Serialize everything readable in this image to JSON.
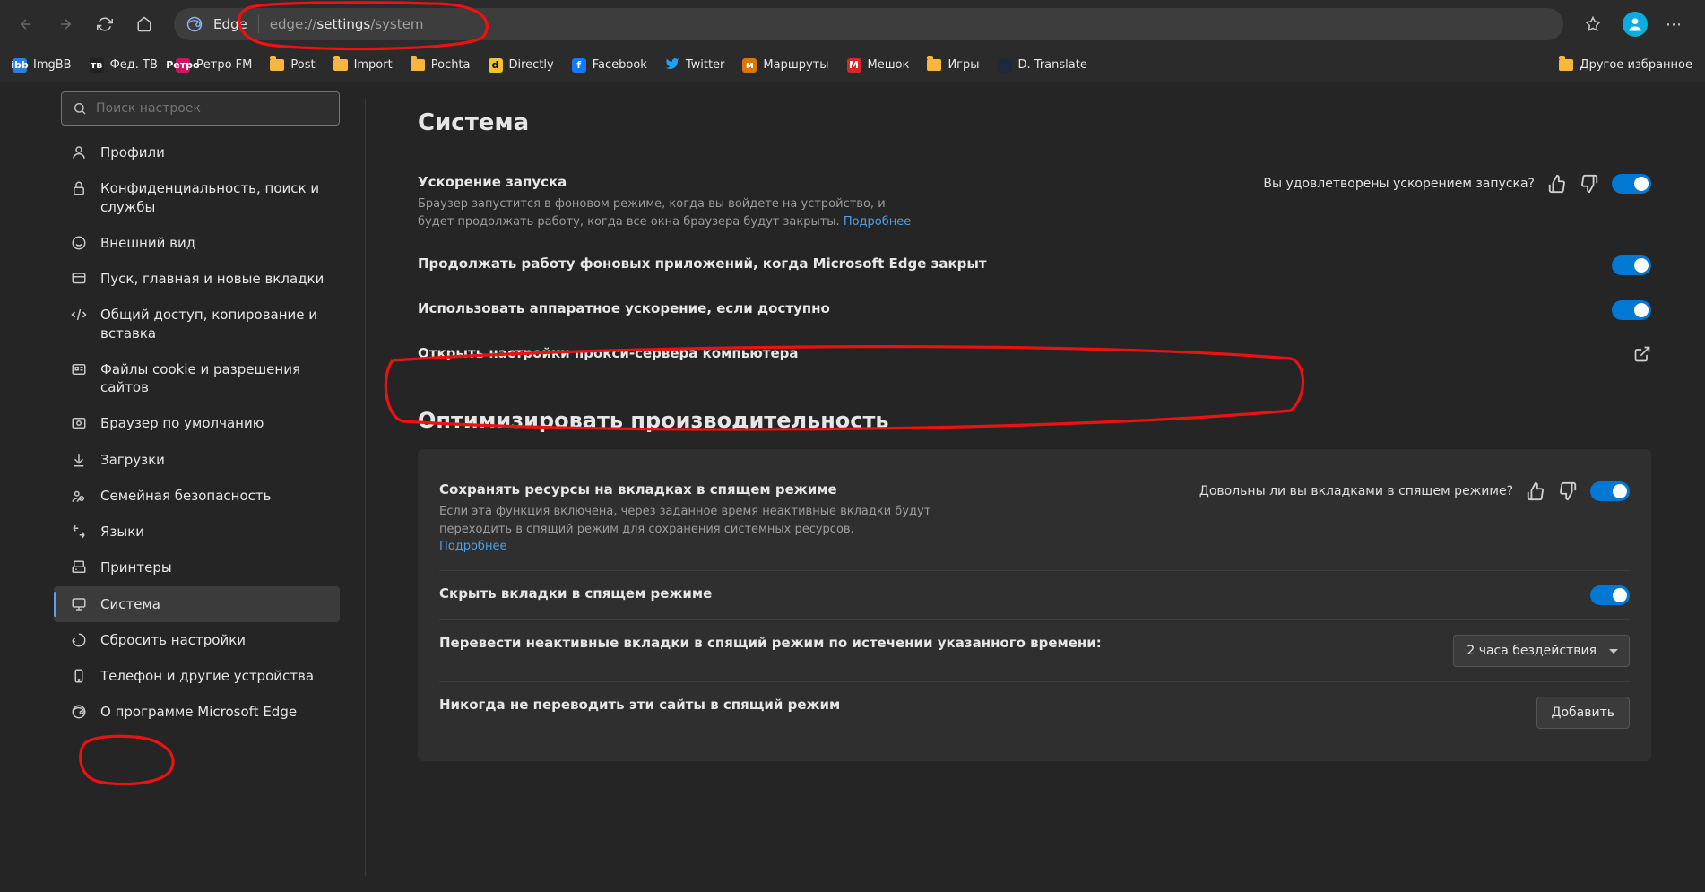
{
  "toolbar": {
    "edge_label": "Edge",
    "url_pre": "edge://",
    "url_mid": "settings",
    "url_post": "/system"
  },
  "bookmarks": {
    "items": [
      {
        "label": "ImgBB",
        "bg": "#2a7fe0",
        "txt": "ibb"
      },
      {
        "label": "Фед. ТВ",
        "bg": "#222",
        "txt": "тв"
      },
      {
        "label": "Ретро FM",
        "bg": "#c91664",
        "txt": "Ретро"
      },
      {
        "label": "Post",
        "folder": true
      },
      {
        "label": "Import",
        "folder": true
      },
      {
        "label": "Pochta",
        "folder": true
      },
      {
        "label": "Directly",
        "bg": "#f4c430",
        "txt": "d",
        "dark": true
      },
      {
        "label": "Facebook",
        "bg": "#1877f2",
        "txt": "f"
      },
      {
        "label": "Twitter",
        "bg": "transparent",
        "txt": "",
        "twitter": true
      },
      {
        "label": "Маршруты",
        "bg": "#d97706",
        "txt": "м"
      },
      {
        "label": "Мешок",
        "bg": "#dc2626",
        "txt": "М"
      },
      {
        "label": "Игры",
        "folder": true
      },
      {
        "label": "D. Translate",
        "bg": "#1e293b",
        "txt": ""
      }
    ],
    "other": "Другое избранное"
  },
  "sidebar": {
    "search_placeholder": "Поиск настроек",
    "items": [
      {
        "label": "Профили"
      },
      {
        "label": "Конфиденциальность, поиск и службы"
      },
      {
        "label": "Внешний вид"
      },
      {
        "label": "Пуск, главная и новые вкладки"
      },
      {
        "label": "Общий доступ, копирование и вставка"
      },
      {
        "label": "Файлы cookie и разрешения сайтов"
      },
      {
        "label": "Браузер по умолчанию"
      },
      {
        "label": "Загрузки"
      },
      {
        "label": "Семейная безопасность"
      },
      {
        "label": "Языки"
      },
      {
        "label": "Принтеры"
      },
      {
        "label": "Система"
      },
      {
        "label": "Сбросить настройки"
      },
      {
        "label": "Телефон и другие устройства"
      },
      {
        "label": "О программе Microsoft Edge"
      }
    ]
  },
  "content": {
    "title1": "Система",
    "startup": {
      "title": "Ускорение запуска",
      "desc": "Браузер запустится в фоновом режиме, когда вы войдете на устройство, и будет продолжать работу, когда все окна браузера будут закрыты. ",
      "link": "Подробнее",
      "feedback": "Вы удовлетворены ускорением запуска?"
    },
    "bg_apps": "Продолжать работу фоновых приложений, когда Microsoft Edge закрыт",
    "hw_accel": "Использовать аппаратное ускорение, если доступно",
    "proxy": "Открыть настройки прокси-сервера компьютера",
    "title2": "Оптимизировать производительность",
    "sleeping": {
      "title": "Сохранять ресурсы на вкладках в спящем режиме",
      "desc": "Если эта функция включена, через заданное время неактивные вкладки будут переходить в спящий режим для сохранения системных ресурсов. ",
      "link": "Подробнее",
      "feedback": "Довольны ли вы вкладками в спящем режиме?"
    },
    "hide_sleeping": "Скрыть вкладки в спящем режиме",
    "sleep_after": "Перевести неактивные вкладки в спящий режим по истечении указанного времени:",
    "sleep_value": "2 часа бездействия",
    "never_sleep": "Никогда не переводить эти сайты в спящий режим",
    "add_btn": "Добавить"
  }
}
